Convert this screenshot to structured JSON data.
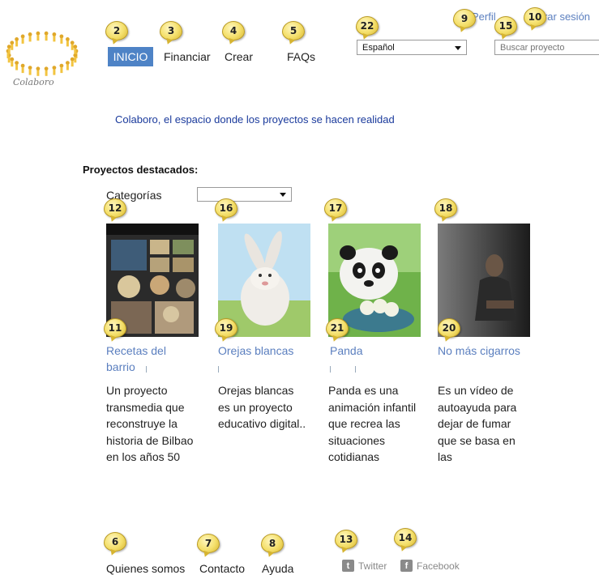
{
  "logo": {
    "text": "Colaboro"
  },
  "nav": {
    "inicio": "INICIO",
    "financiar": "Financiar",
    "crear": "Crear",
    "faqs": "FAQs"
  },
  "top": {
    "perfil": "Perfil",
    "cerrar": "Cerrar sesión"
  },
  "language": {
    "selected": "Español"
  },
  "search": {
    "placeholder": "Buscar proyecto"
  },
  "slogan": "Colaboro, el espacio donde los proyectos se hacen realidad",
  "featured": {
    "title": "Proyectos destacados:",
    "category_label": "Categorías",
    "projects": [
      {
        "title": "Recetas del barrio",
        "description": "Un proyecto transmedia que reconstruye la historia de Bilbao en los años 50"
      },
      {
        "title": "Orejas blancas",
        "description": "Orejas blancas es un proyecto educativo digital.."
      },
      {
        "title": "Panda",
        "description": "Panda es una animación infantil que recrea las situaciones cotidianas"
      },
      {
        "title": "No más cigarros",
        "description": "Es un vídeo de autoayuda para dejar de fumar que se basa en las"
      }
    ]
  },
  "footer": {
    "quienes": "Quienes somos",
    "contacto": "Contacto",
    "ayuda": "Ayuda",
    "twitter": "Twitter",
    "facebook": "Facebook"
  },
  "bubbles": {
    "b2": "2",
    "b3": "3",
    "b4": "4",
    "b5": "5",
    "b22": "22",
    "b9": "9",
    "b15": "15",
    "b10": "10",
    "b12": "12",
    "b16": "16",
    "b17": "17",
    "b18": "18",
    "b11": "11",
    "b19": "19",
    "b21": "21",
    "b20": "20",
    "b6": "6",
    "b7": "7",
    "b8": "8",
    "b13": "13",
    "b14": "14"
  },
  "colors": {
    "nav_active": "#4e83c6",
    "link": "#5b7fbf",
    "slogan": "#1a3a9c",
    "bubble": "#f4df6a"
  },
  "icons": [
    "sun-ring-logo-icon",
    "chevron-down-icon",
    "twitter-icon",
    "facebook-icon"
  ]
}
